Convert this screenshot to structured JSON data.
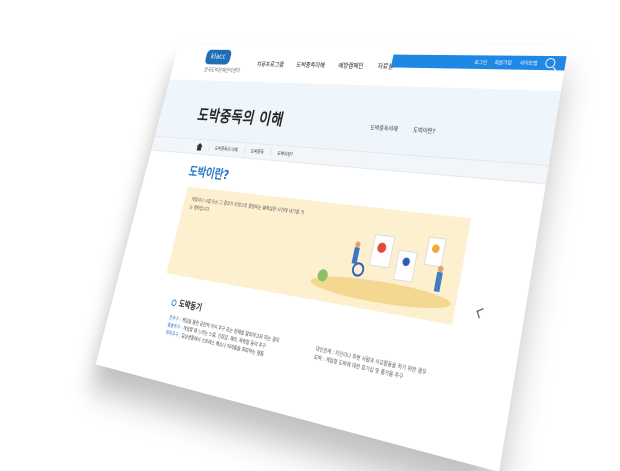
{
  "header": {
    "logo": "klacc",
    "logo_sub": "한국도박문제관리센터",
    "nav": [
      "치유프로그램",
      "도박중독이해",
      "예방캠페인",
      "자료실",
      "KLACC"
    ],
    "util": [
      "로그인",
      "회원가입",
      "사이트맵"
    ]
  },
  "hero": {
    "title": "도박중독의 이해",
    "sub_nav": [
      "도박중독이해",
      "도박이란?"
    ]
  },
  "breadcrumb": [
    "도박중독의 이해",
    "도박중독",
    "도박이란?"
  ],
  "section_title": "도박이란?",
  "banner": {
    "text": "게임이나 시합 또는 그 결과가 우연으로 결정되는 불확실한 사건에 내기를 거는 행위입니다."
  },
  "motivation": {
    "title": "도박동기",
    "left": [
      {
        "key": "돈추구",
        "text": " : 게임을 통한 금전적 이익 추구 또는 현재를 탈피하고자 하는 경우"
      },
      {
        "key": "흥분추구",
        "text": " : 게임할 때 느끼는 스릴, 긴장감, 재미, 짜릿함 등의 추구"
      },
      {
        "key": "회피추구",
        "text": " : 일상생활에서 스트레스 해소나 어려움을 회피하는 행동"
      }
    ],
    "right": [
      "대인관계 : 지인이나 주변 사람과 사교활동을 하기 위한 경우",
      "도박 : 게임형 도박에 대한 호기심 및 즐거움 추구"
    ]
  },
  "colors": {
    "accent": "#1b6fc3",
    "utilbar": "#1f88e5",
    "hero_bg": "#eef5fb",
    "banner_bg": "#fdf0cf"
  }
}
